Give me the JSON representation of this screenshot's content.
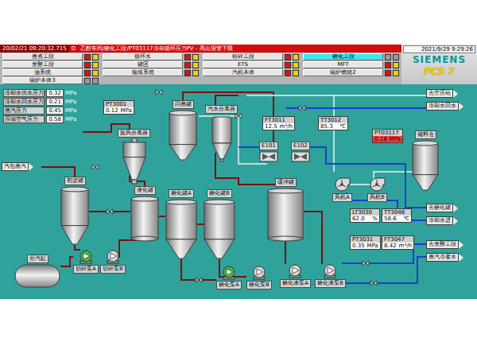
{
  "alarm_bar": {
    "time": "20/02/21 09:20:32.715",
    "severity": "D",
    "message": "乙醇车间/糖化工段/PT03117冷却循环压力PV - 高出报警下限"
  },
  "nav": [
    {
      "label": "蒸煮工段",
      "selected": false,
      "alarm": true
    },
    {
      "label": "循环水",
      "selected": false,
      "alarm": true
    },
    {
      "label": "粉碎工段",
      "selected": false,
      "alarm": true
    },
    {
      "label": "糖化工段",
      "selected": true,
      "alarm": false
    },
    {
      "label": "发酵工段",
      "selected": false,
      "alarm": true
    },
    {
      "label": "罐区",
      "selected": false,
      "alarm": true
    },
    {
      "label": "ETS",
      "selected": false,
      "alarm": true
    },
    {
      "label": "MFT",
      "selected": false,
      "alarm": true
    },
    {
      "label": "油系统",
      "selected": false,
      "alarm": true
    },
    {
      "label": "输煤系统",
      "selected": false,
      "alarm": true
    },
    {
      "label": "汽机本体",
      "selected": false,
      "alarm": true
    },
    {
      "label": "锅炉燃烧2",
      "selected": false,
      "alarm": true
    },
    {
      "label": "锅炉本体3",
      "selected": false,
      "alarm": false
    }
  ],
  "clock": "2021/9/29 9:29:26",
  "logo": {
    "brand": "SIEMENS",
    "product": "PCS 7"
  },
  "utilities": [
    {
      "label": "冷却水供水压力",
      "value": "0.32",
      "unit": "MPa"
    },
    {
      "label": "冷却水回水压力",
      "value": "0.21",
      "unit": "MPa"
    },
    {
      "label": "蒸汽压力",
      "value": "0.45",
      "unit": "MPa"
    },
    {
      "label": "压缩空气压力",
      "value": "0.58",
      "unit": "MPa"
    }
  ],
  "streams": [
    {
      "label": "汽包蒸汽"
    },
    {
      "label": "去空压站"
    },
    {
      "label": "冷却水回水"
    },
    {
      "label": "去糖化罐"
    },
    {
      "label": "冷却水进"
    },
    {
      "label": "去发酵工段"
    },
    {
      "label": "蒸汽冷凝水"
    }
  ],
  "vessels": [
    {
      "kind": "cyclone",
      "label": "旋风分离器"
    },
    {
      "kind": "cone",
      "label": "闪蒸罐"
    },
    {
      "kind": "filter",
      "label": "汽水分离器"
    },
    {
      "kind": "cone",
      "label": "初淀罐"
    },
    {
      "kind": "drum",
      "label": "液化罐"
    },
    {
      "kind": "cone",
      "label": "糖化罐A"
    },
    {
      "kind": "cone",
      "label": "糖化罐B"
    },
    {
      "kind": "drum",
      "label": "缓冲罐"
    },
    {
      "kind": "cone",
      "label": "储料仓"
    },
    {
      "kind": "horizontal",
      "label": "分汽缸"
    }
  ],
  "exchangers": [
    {
      "label": "E101"
    },
    {
      "label": "E102"
    }
  ],
  "equipment": [
    {
      "kind": "pump",
      "label": "切碎泵A",
      "running": true
    },
    {
      "kind": "pump",
      "label": "切碎泵B",
      "running": false
    },
    {
      "kind": "pump",
      "label": "糖化泵A",
      "running": true
    },
    {
      "kind": "pump",
      "label": "糖化泵B",
      "running": false
    },
    {
      "kind": "pump",
      "label": "糖化液泵A",
      "running": false
    },
    {
      "kind": "pump",
      "label": "糖化液泵B",
      "running": false
    },
    {
      "kind": "fan",
      "label": "风机A",
      "running": false
    },
    {
      "kind": "fan",
      "label": "风机B",
      "running": false
    }
  ],
  "instruments": [
    {
      "label": "PT3001",
      "value": "0.12",
      "unit": "MPa",
      "alarm": false
    },
    {
      "label": "FT3011",
      "value": "12.5",
      "unit": "m³/h",
      "alarm": false
    },
    {
      "label": "TT3012",
      "value": "85.3",
      "unit": "℃",
      "alarm": false
    },
    {
      "label": "LT3030",
      "value": "62.0",
      "unit": "%",
      "alarm": false
    },
    {
      "label": "TT3046",
      "value": "58.6",
      "unit": "℃",
      "alarm": false
    },
    {
      "label": "PT3031",
      "value": "0.35",
      "unit": "MPa",
      "alarm": false
    },
    {
      "label": "FT3047",
      "value": "8.42",
      "unit": "m³/h",
      "alarm": false
    },
    {
      "label": "PT03117",
      "value": "0.18",
      "unit": "MPa",
      "alarm": true
    }
  ]
}
